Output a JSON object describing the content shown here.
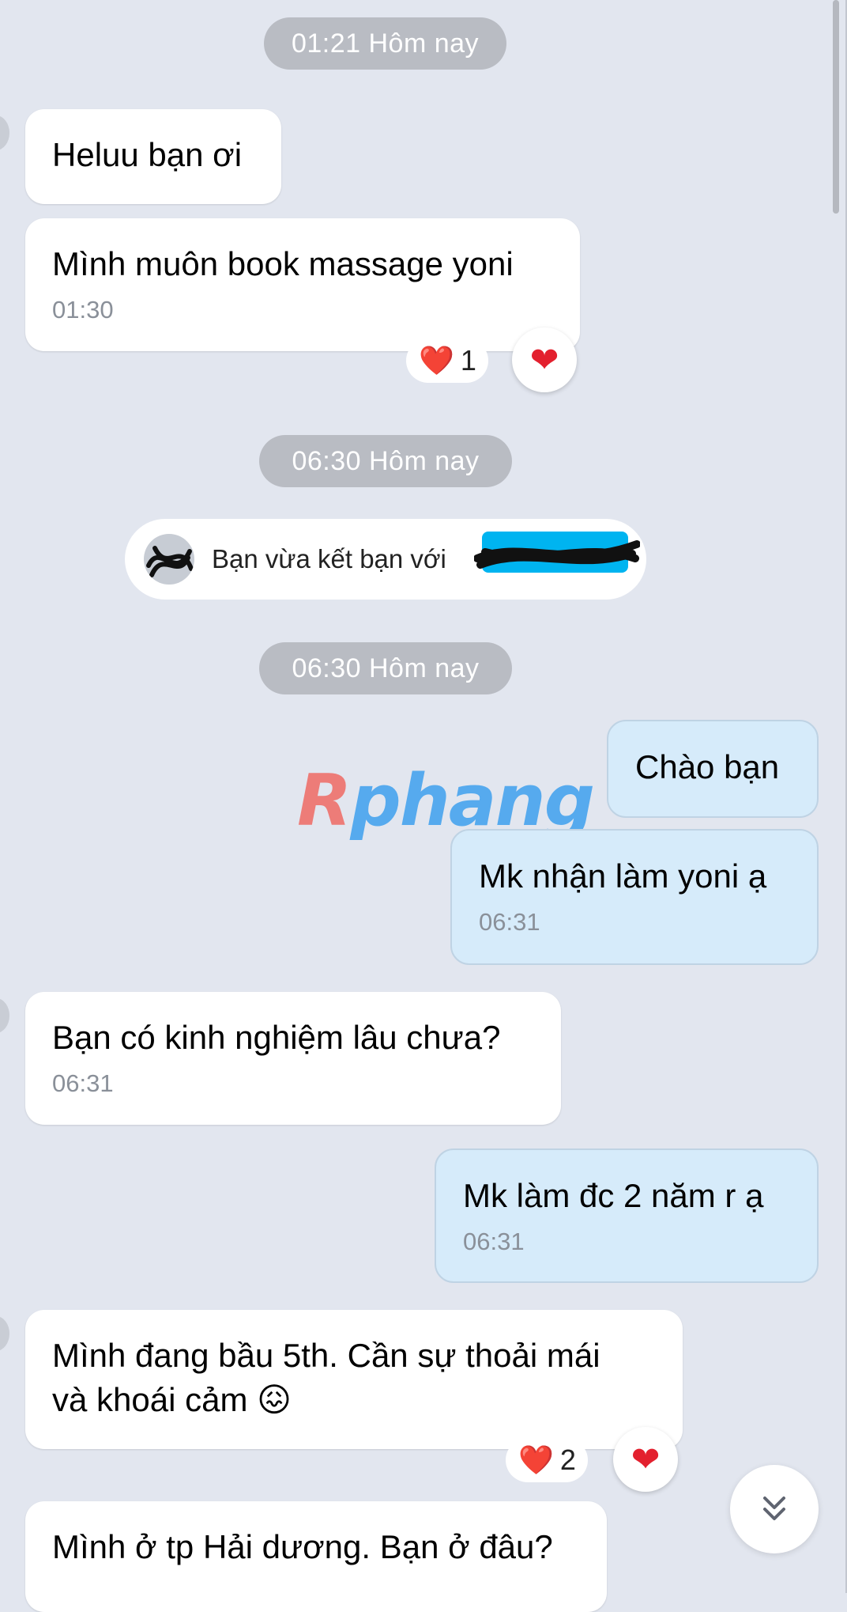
{
  "chat": {
    "timestamps": [
      "01:21 Hôm nay",
      "06:30 Hôm nay",
      "06:30 Hôm nay"
    ],
    "messages": [
      {
        "text": "Heluu bạn ơi"
      },
      {
        "text": "Mình muôn book massage yoni",
        "time": "01:30"
      },
      {
        "text": "Chào bạn"
      },
      {
        "text": "Mk nhận làm yoni ạ",
        "time": "06:31"
      },
      {
        "text": "Bạn có kinh nghiệm lâu chưa?",
        "time": "06:31"
      },
      {
        "text": "Mk làm đc 2 năm r ạ",
        "time": "06:31"
      },
      {
        "line1": "Mình đang bầu 5th. Cần sự thoải mái",
        "line2": "và khoái cảm 😖"
      },
      {
        "text": "Mình ở tp Hải dương. Bạn ở đâu?"
      }
    ],
    "reactions": [
      {
        "icon": "❤️",
        "count": "1"
      },
      {
        "icon": "❤️",
        "count": "2"
      }
    ],
    "system_notice": "Bạn vừa kết bạn với",
    "watermark": {
      "first": "R",
      "rest": "phang"
    }
  },
  "colors": {
    "background": "#e2e6ef",
    "incoming_bubble": "#ffffff",
    "outgoing_bubble": "#d6ebfa",
    "timestamp_pill": "#b9bcc3",
    "heart": "#e3202e"
  }
}
